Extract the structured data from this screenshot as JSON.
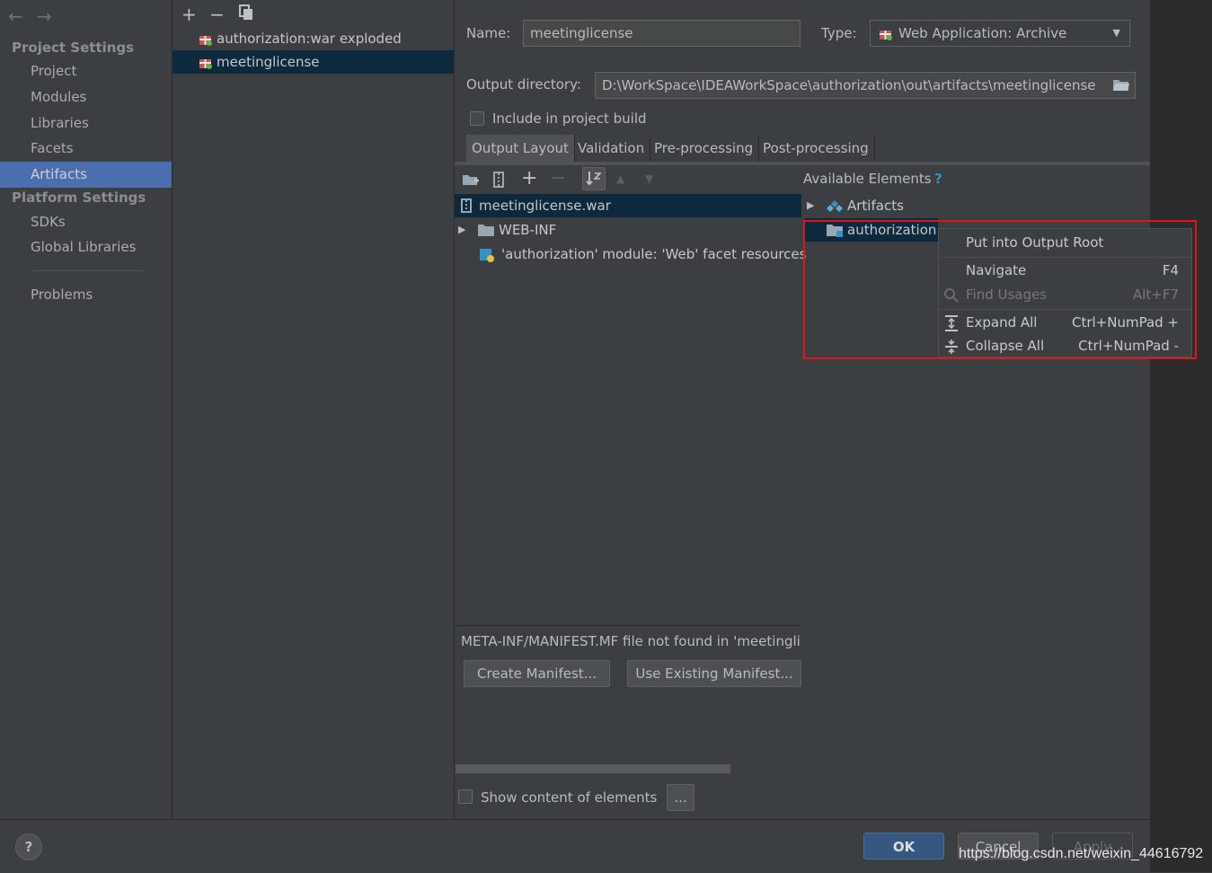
{
  "sidebar": {
    "project_settings_title": "Project Settings",
    "platform_settings_title": "Platform Settings",
    "items": [
      {
        "label": "Project"
      },
      {
        "label": "Modules"
      },
      {
        "label": "Libraries"
      },
      {
        "label": "Facets"
      },
      {
        "label": "Artifacts"
      },
      {
        "label": "SDKs"
      },
      {
        "label": "Global Libraries"
      },
      {
        "label": "Problems"
      }
    ]
  },
  "artifacts": {
    "items": [
      {
        "label": "authorization:war exploded"
      },
      {
        "label": "meetinglicense"
      }
    ]
  },
  "form": {
    "name_label": "Name:",
    "name_value": "meetinglicense",
    "type_label": "Type:",
    "type_value": "Web Application: Archive",
    "output_label": "Output directory:",
    "output_value": "D:\\WorkSpace\\IDEAWorkSpace\\authorization\\out\\artifacts\\meetinglicense",
    "include_label": "Include in project build"
  },
  "tabs": [
    {
      "label": "Output Layout"
    },
    {
      "label": "Validation"
    },
    {
      "label": "Pre-processing"
    },
    {
      "label": "Post-processing"
    }
  ],
  "layout_tree": {
    "root": "meetinglicense.war",
    "webinf": "WEB-INF",
    "facet": "'authorization' module: 'Web' facet resources"
  },
  "available": {
    "title": "Available Elements",
    "help": "?",
    "artifacts": "Artifacts",
    "authorization": "authorization"
  },
  "context_menu": {
    "items": [
      {
        "label": "Put into Output Root",
        "shortcut": ""
      },
      {
        "label": "Navigate",
        "shortcut": "F4"
      },
      {
        "label": "Find Usages",
        "shortcut": "Alt+F7"
      },
      {
        "label": "Expand All",
        "shortcut": "Ctrl+NumPad +"
      },
      {
        "label": "Collapse All",
        "shortcut": "Ctrl+NumPad -"
      }
    ]
  },
  "manifest": {
    "message": "META-INF/MANIFEST.MF file not found in 'meetingli",
    "create_label": "Create Manifest...",
    "use_existing_label": "Use Existing Manifest..."
  },
  "show_content_label": "Show content of elements",
  "ellipsis_label": "...",
  "dialog": {
    "help": "?",
    "ok": "OK",
    "cancel": "Cancel",
    "apply": "Apply"
  },
  "watermark": "https://blog.csdn.net/weixin_44616792",
  "colors": {
    "accent_selection": "#4b6eaf",
    "highlight_box": "#e0141b",
    "ok_button": "#365880"
  }
}
